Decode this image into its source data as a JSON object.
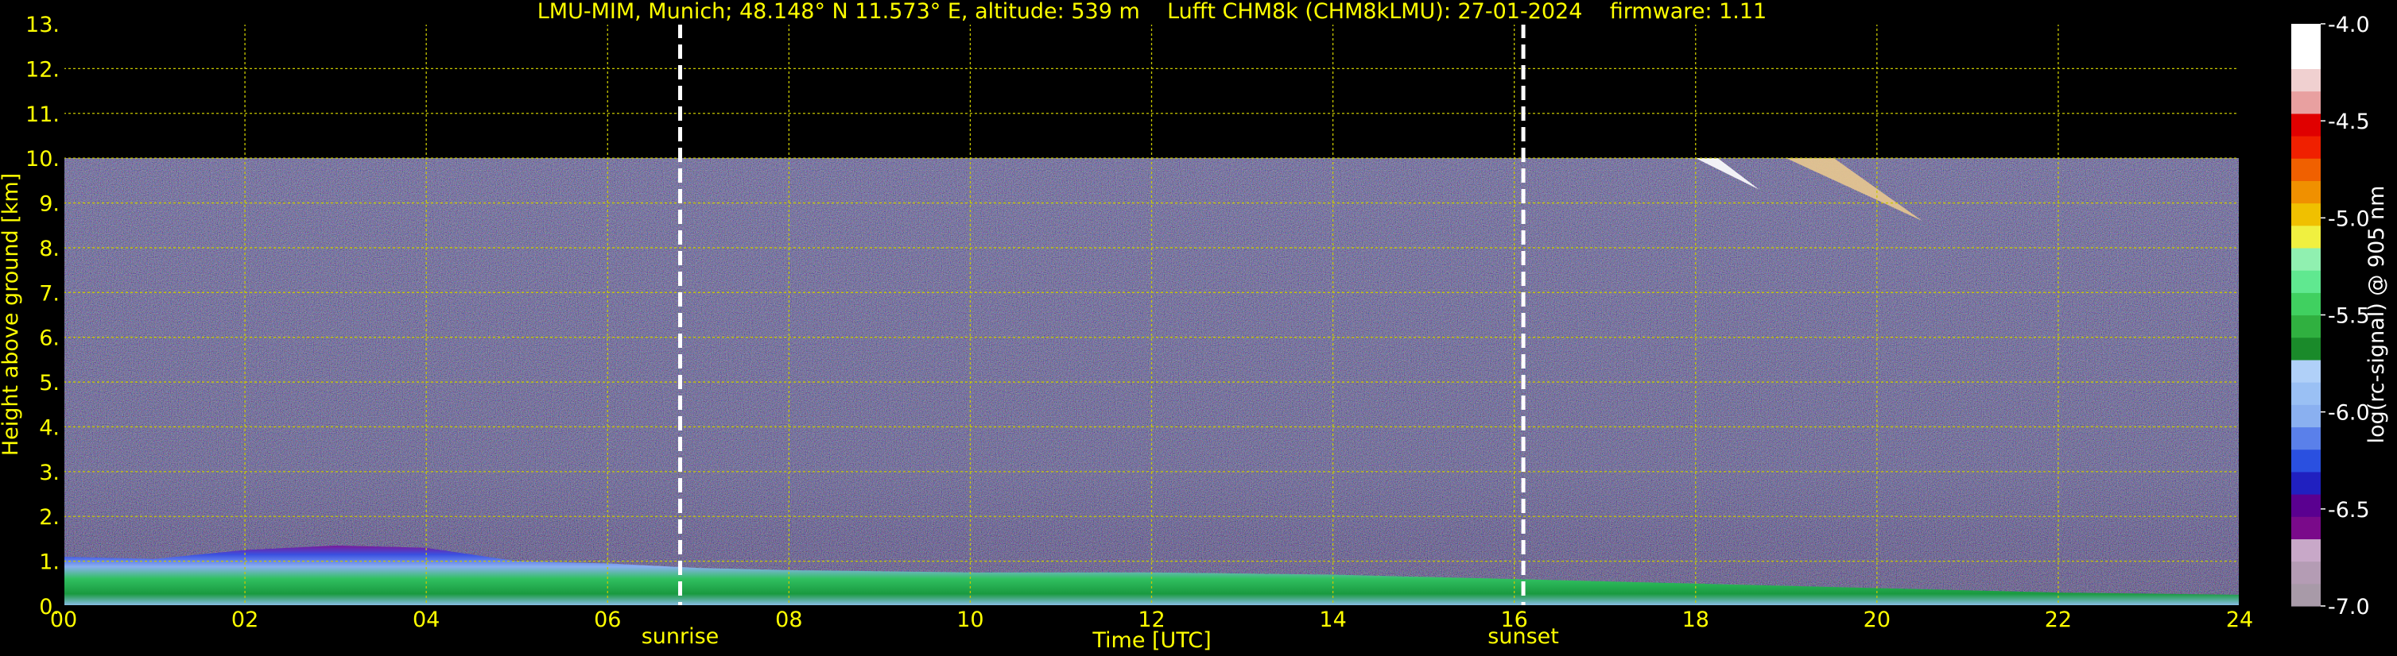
{
  "chart_data": {
    "type": "heatmap",
    "title": "LMU-MIM, Munich; 48.148° N 11.573° E, altitude: 539 m    Lufft CHM8k (CHM8kLMU): 27-01-2024    firmware: 1.11",
    "xlabel": "Time [UTC]",
    "ylabel": "Height above ground [km]",
    "xlim": [
      0,
      24
    ],
    "ylim": [
      0,
      13
    ],
    "x_ticks": [
      "00",
      "02",
      "04",
      "06",
      "08",
      "10",
      "12",
      "14",
      "16",
      "18",
      "20",
      "22",
      "24"
    ],
    "y_ticks": [
      "0.",
      "1.",
      "2.",
      "3.",
      "4.",
      "5.",
      "6.",
      "7.",
      "8.",
      "9.",
      "10.",
      "11.",
      "12.",
      "13."
    ],
    "grid": true,
    "grid_color": "#c8c800",
    "text_color": "#ffff00",
    "data_top_km": 10,
    "events": [
      {
        "label": "sunrise",
        "hour": 6.8
      },
      {
        "label": "sunset",
        "hour": 16.1
      }
    ],
    "colorbar": {
      "label": "log(rc-signal) @ 905 nm",
      "range": [
        -7.0,
        -4.0
      ],
      "ticks": [
        "-4.0",
        "-4.5",
        "-5.0",
        "-5.5",
        "-6.0",
        "-6.5",
        "-7.0"
      ],
      "colors": [
        "#a89aa8",
        "#b49cb4",
        "#c8a8c8",
        "#7a0a8a",
        "#5a0090",
        "#2020c0",
        "#2a50e0",
        "#5a80ea",
        "#8ab0f0",
        "#9ac0f4",
        "#b0d0f8",
        "#1a8a2a",
        "#30b040",
        "#40d060",
        "#60e890",
        "#90f0b0",
        "#f0f040",
        "#f0c000",
        "#f09000",
        "#f06000",
        "#f02000",
        "#e00000",
        "#e8a0a0",
        "#f0d0d0",
        "#ffffff",
        "#ffffff"
      ]
    },
    "boundary_layer_top_km": [
      {
        "hour": 0,
        "value": 1.1
      },
      {
        "hour": 1,
        "value": 1.05
      },
      {
        "hour": 2,
        "value": 1.25
      },
      {
        "hour": 3,
        "value": 1.35
      },
      {
        "hour": 4,
        "value": 1.3
      },
      {
        "hour": 5,
        "value": 1.0
      },
      {
        "hour": 6,
        "value": 0.95
      },
      {
        "hour": 7,
        "value": 0.85
      },
      {
        "hour": 8,
        "value": 0.8
      },
      {
        "hour": 10,
        "value": 0.75
      },
      {
        "hour": 12,
        "value": 0.75
      },
      {
        "hour": 14,
        "value": 0.7
      },
      {
        "hour": 16,
        "value": 0.6
      },
      {
        "hour": 18,
        "value": 0.5
      },
      {
        "hour": 20,
        "value": 0.4
      },
      {
        "hour": 22,
        "value": 0.3
      },
      {
        "hour": 24,
        "value": 0.25
      }
    ],
    "cirrus_features": [
      {
        "hour_start": 18.0,
        "hour_end": 18.7,
        "km_top": 10.0,
        "km_bottom": 9.3
      },
      {
        "hour_start": 19.0,
        "hour_end": 20.5,
        "km_top": 10.0,
        "km_bottom": 8.6
      }
    ]
  }
}
